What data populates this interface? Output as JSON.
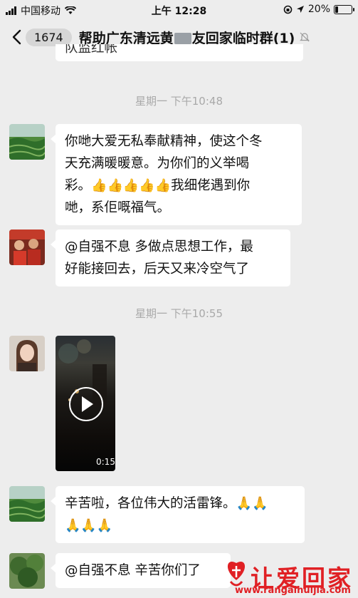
{
  "status_bar": {
    "carrier": "中国移动",
    "time": "上午 12:28",
    "battery": "20%",
    "battery_level": 0.2
  },
  "header": {
    "unread_count": "1674",
    "title_before": "帮助广东清远黄",
    "title_after": "友回家临时群(1)"
  },
  "messages": {
    "prev_tail": "队监红帐",
    "ts1": "星期一 下午10:48",
    "msg1_line1": "你哋大爱无私奉献精神，使这个冬",
    "msg1_line2": "天充满暖暖意。为你们的义举喝",
    "msg1_line3_pre": "彩。",
    "msg1_line3_post": "我细佬遇到你",
    "msg1_line4": "哋，系佢嘅福气。",
    "msg2_line1": "@自强不息 多做点思想工作，最",
    "msg2_line2": "好能接回去，后天又来冷空气了",
    "ts2": "星期一 下午10:55",
    "video_duration": "0:15",
    "msg3_line1": "辛苦啦，各位伟大的活雷锋。",
    "msg4_line1": "@自强不息 辛苦你们了"
  },
  "watermark": {
    "text": "让爱回家",
    "url": "www.rangaihuijia.com"
  }
}
